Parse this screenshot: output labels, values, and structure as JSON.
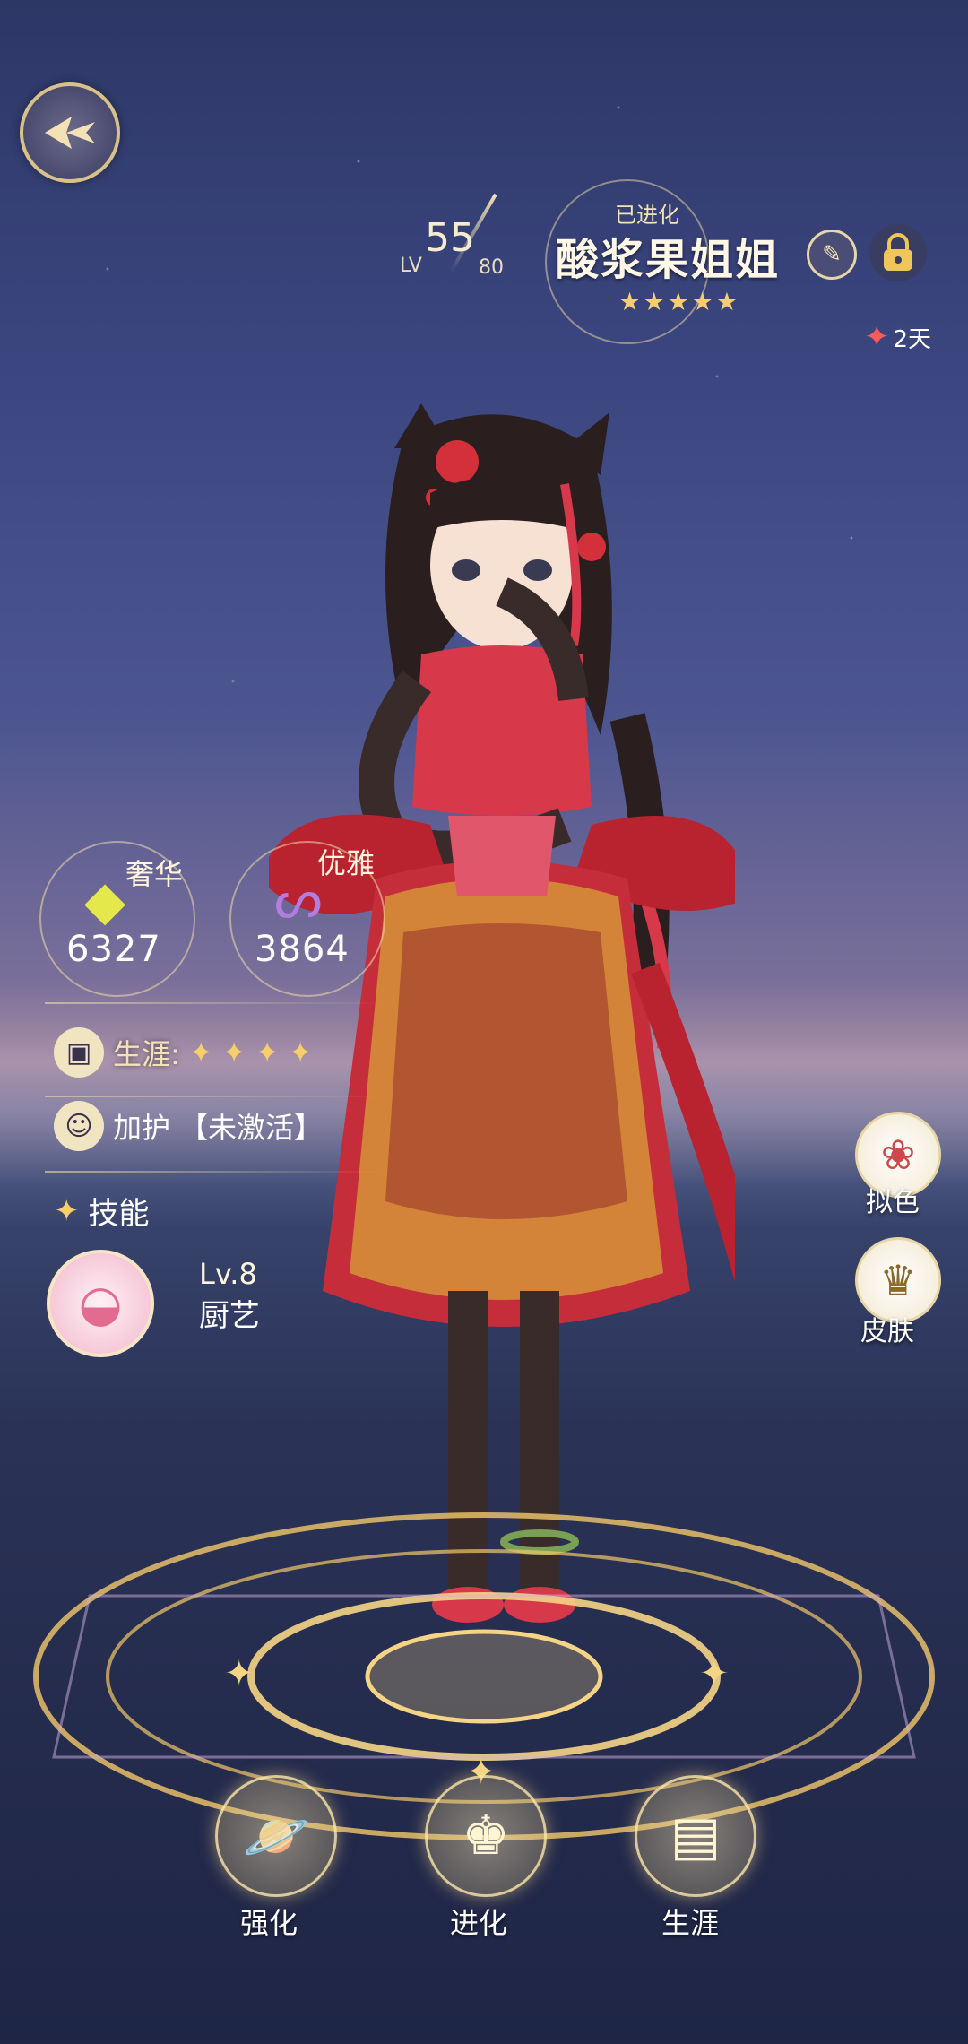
{
  "header": {
    "lv_label": "LV",
    "level": "55",
    "max_level": "80",
    "evolved_label": "已进化",
    "name": "酸浆果姐姐",
    "rarity_stars": "★★★★★",
    "days": "2天"
  },
  "stats": [
    {
      "name": "奢华",
      "value": "6327",
      "icon": "diamond-icon",
      "color": "#e4e84a"
    },
    {
      "name": "优雅",
      "value": "3864",
      "icon": "swan-icon",
      "color": "#b27de0"
    }
  ],
  "career": {
    "label": "生涯:",
    "stars": "✦ ✦ ✦ ✦"
  },
  "blessing": {
    "label": "加护",
    "status": "【未激活】"
  },
  "skills": {
    "title": "技能",
    "level": "Lv.8",
    "name": "厨艺"
  },
  "side_buttons": [
    {
      "label": "拟色",
      "icon": "dye-icon"
    },
    {
      "label": "皮肤",
      "icon": "outfit-icon"
    }
  ],
  "bottom_buttons": [
    {
      "label": "强化",
      "icon": "planet-icon"
    },
    {
      "label": "进化",
      "icon": "crown-icon"
    },
    {
      "label": "生涯",
      "icon": "scroll-icon"
    }
  ],
  "colors": {
    "accent_gold": "#f3e2b6",
    "dress_red": "#d8394a",
    "star": "#f6cf6a"
  }
}
